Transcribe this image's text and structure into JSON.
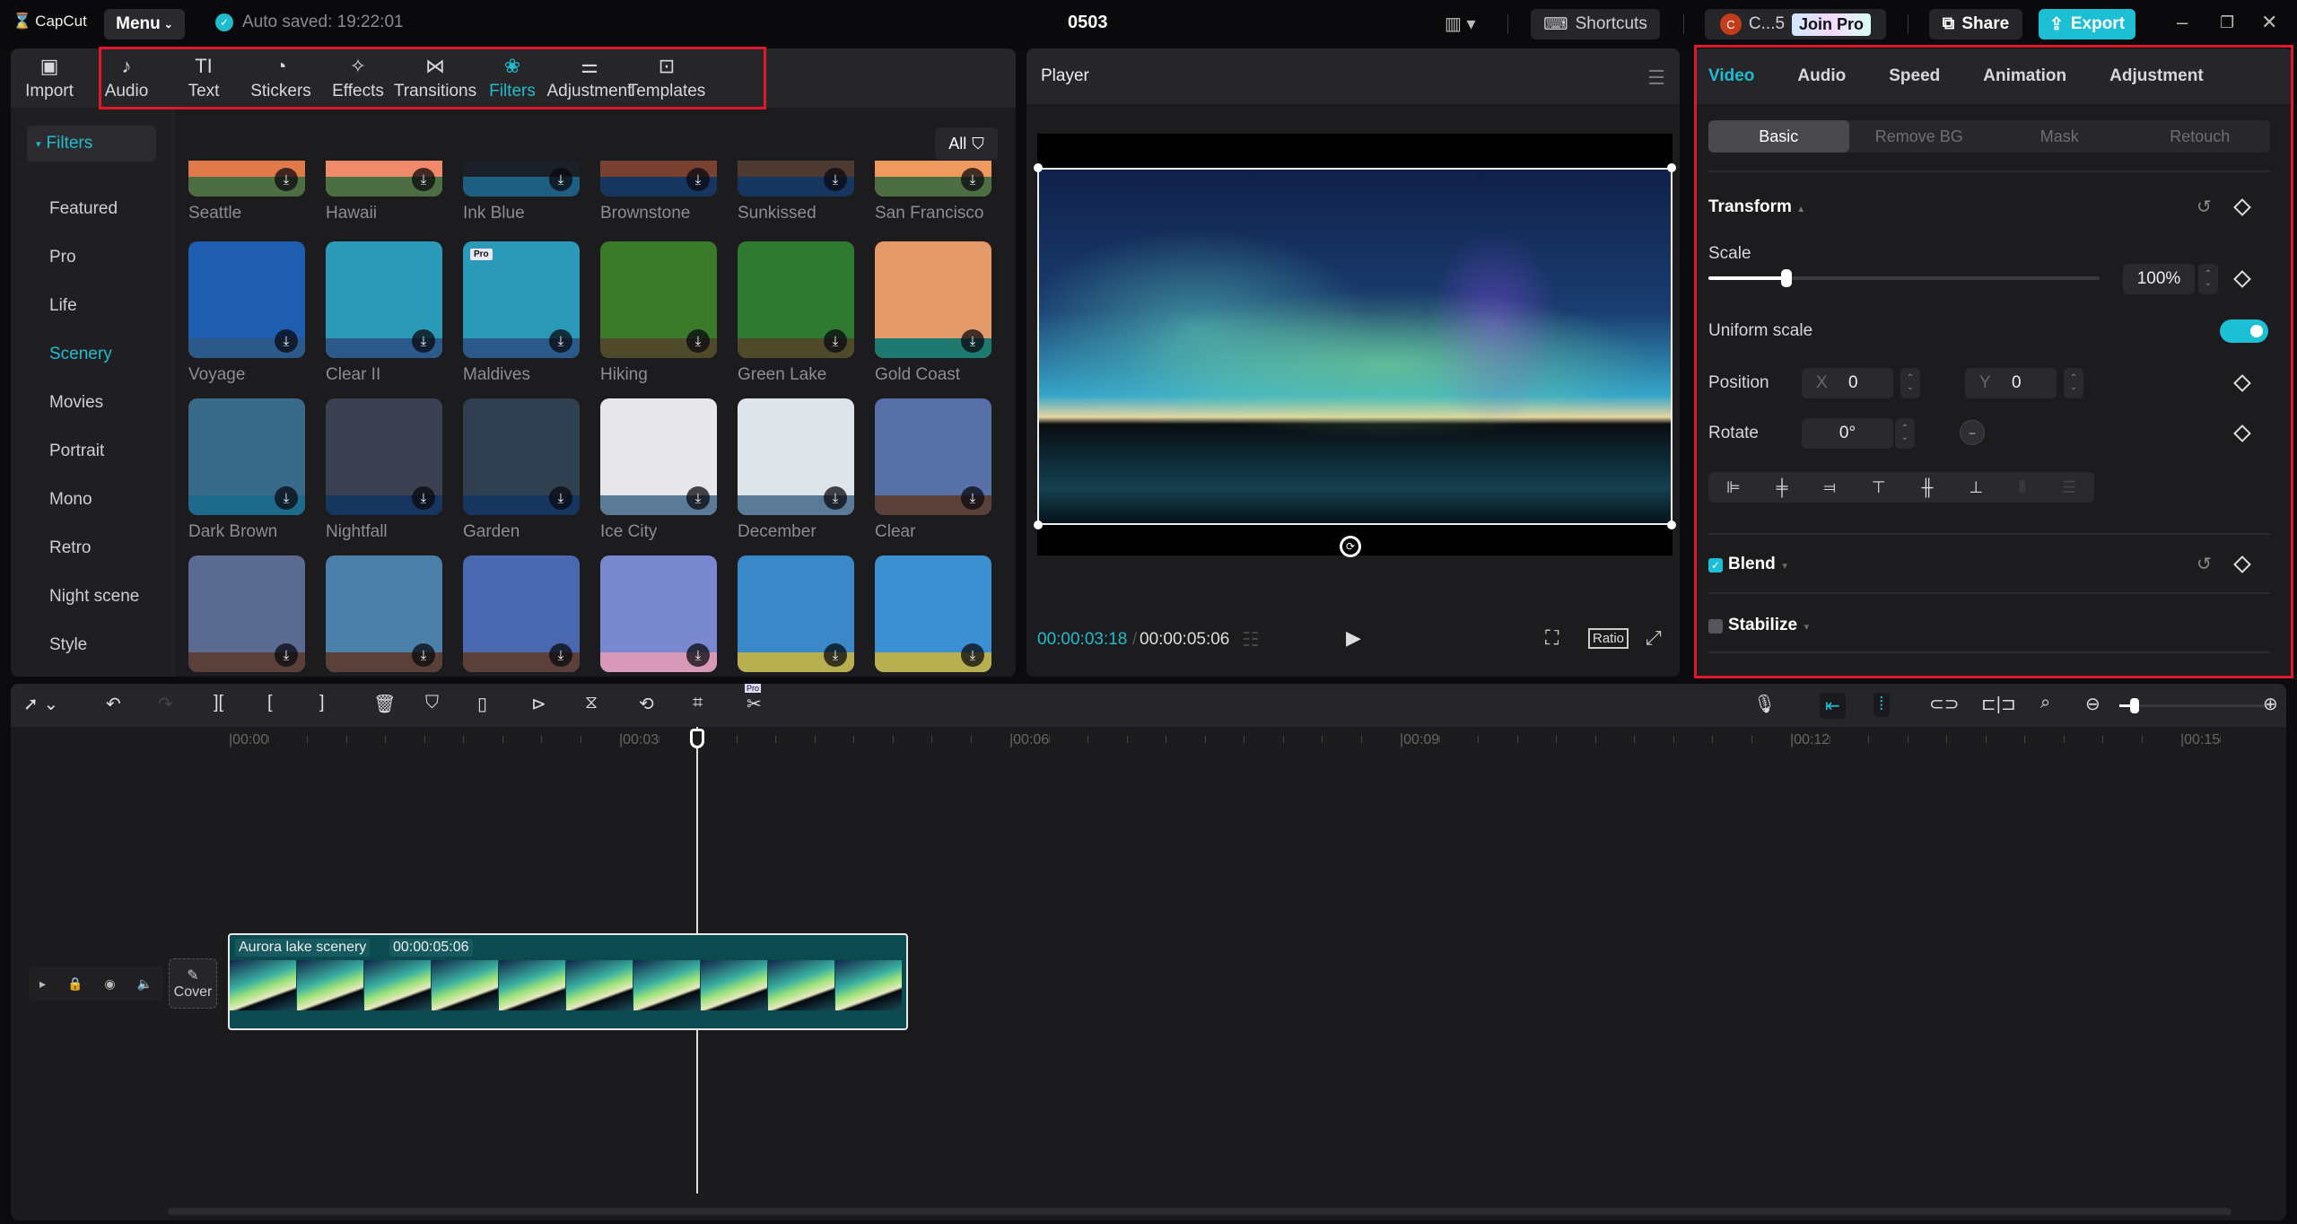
{
  "app": {
    "logo": "CapCut",
    "menu_label": "Menu",
    "autosave": "Auto saved: 19:22:01",
    "project_title": "0503"
  },
  "header": {
    "shortcuts_label": "Shortcuts",
    "user_initial": "C",
    "user_name": "C...5",
    "join_pro_label": "Join Pro",
    "share_label": "Share",
    "export_label": "Export"
  },
  "media_tabs": [
    {
      "label": "Import",
      "icon": "import-icon",
      "glyph": "▣"
    },
    {
      "label": "Audio",
      "icon": "audio-icon",
      "glyph": "♪"
    },
    {
      "label": "Text",
      "icon": "text-icon",
      "glyph": "TI"
    },
    {
      "label": "Stickers",
      "icon": "sticker-icon",
      "glyph": "◔"
    },
    {
      "label": "Effects",
      "icon": "effects-icon",
      "glyph": "✧"
    },
    {
      "label": "Transitions",
      "icon": "transitions-icon",
      "glyph": "⋈"
    },
    {
      "label": "Filters",
      "icon": "filters-icon",
      "glyph": "❀",
      "active": true
    },
    {
      "label": "Adjustment",
      "icon": "adjustment-icon",
      "glyph": "⚌"
    },
    {
      "label": "Templates",
      "icon": "templates-icon",
      "glyph": "⊡"
    }
  ],
  "sidebar": {
    "header": "Filters",
    "items": [
      "Featured",
      "Pro",
      "Life",
      "Scenery",
      "Movies",
      "Portrait",
      "Mono",
      "Retro",
      "Night scene",
      "Style"
    ],
    "active": "Scenery"
  },
  "filter_sort": "All",
  "filters": [
    {
      "name": "Seattle",
      "top": "#e07a4a",
      "band": "#4d6e42"
    },
    {
      "name": "Hawaii",
      "top": "#f08a6a",
      "band": "#4d6e42"
    },
    {
      "name": "Ink Blue",
      "top": "#1a1f28",
      "band": "#1e5e80"
    },
    {
      "name": "Brownstone",
      "top": "#7a4030",
      "band": "#163660"
    },
    {
      "name": "Sunkissed",
      "top": "#4e3a30",
      "band": "#163660"
    },
    {
      "name": "San Francisco",
      "top": "#f09a60",
      "band": "#4d6e42"
    },
    {
      "name": "Voyage",
      "top": "#1f5db0",
      "band": "#2b5a8a"
    },
    {
      "name": "Clear II",
      "top": "#2a9ab8",
      "band": "#2b5a8a"
    },
    {
      "name": "Maldives",
      "top": "#2a9ab8",
      "band": "#2b5a8a",
      "pro": true
    },
    {
      "name": "Hiking",
      "top": "#3a7a28",
      "band": "#4e4a2a"
    },
    {
      "name": "Green Lake",
      "top": "#2e7a30",
      "band": "#4e4a2a"
    },
    {
      "name": "Gold Coast",
      "top": "#e59a6a",
      "band": "#1e7a70"
    },
    {
      "name": "Dark Brown",
      "top": "#3a6a8a",
      "band": "#1e6a8a"
    },
    {
      "name": "Nightfall",
      "top": "#3a4050",
      "band": "#163660"
    },
    {
      "name": "Garden",
      "top": "#304050",
      "band": "#163660"
    },
    {
      "name": "Ice City",
      "top": "#e8e8ea",
      "band": "#5a7a98"
    },
    {
      "name": "December",
      "top": "#dde4ea",
      "band": "#5a7a98"
    },
    {
      "name": "Clear",
      "top": "#5870a8",
      "band": "#5a4038"
    },
    {
      "name": "",
      "top": "#5a6a90",
      "band": "#5a4038"
    },
    {
      "name": "",
      "top": "#4a80a8",
      "band": "#5a4038"
    },
    {
      "name": "",
      "top": "#4a68b0",
      "band": "#5a4038"
    },
    {
      "name": "",
      "top": "#7a88d0",
      "band": "#d898b8"
    },
    {
      "name": "",
      "top": "#3a88c8",
      "band": "#b8b050"
    },
    {
      "name": "",
      "top": "#3a90d0",
      "band": "#b8b050"
    }
  ],
  "player": {
    "title": "Player",
    "current_time": "00:00:03:18",
    "total_time": "00:00:05:06",
    "ratio_label": "Ratio"
  },
  "inspector": {
    "tabs": [
      "Video",
      "Audio",
      "Speed",
      "Animation",
      "Adjustment"
    ],
    "active_tab": "Video",
    "subtabs": [
      "Basic",
      "Remove BG",
      "Mask",
      "Retouch"
    ],
    "active_subtab": "Basic",
    "transform_label": "Transform",
    "scale_label": "Scale",
    "scale_value": "100%",
    "scale_slider_fraction": 0.2,
    "uniform_scale_label": "Uniform scale",
    "uniform_scale_on": true,
    "position_label": "Position",
    "pos_x_label": "X",
    "pos_x": "0",
    "pos_y_label": "Y",
    "pos_y": "0",
    "rotate_label": "Rotate",
    "rotate_value": "0°",
    "blend_label": "Blend",
    "blend_checked": true,
    "stabilize_label": "Stabilize",
    "stabilize_checked": false
  },
  "timeline": {
    "ruler": [
      "00:00",
      "00:03",
      "00:06",
      "00:09",
      "00:12",
      "00:15"
    ],
    "cover_label": "Cover",
    "clip_name": "Aurora lake scenery",
    "clip_duration": "00:00:05:06",
    "zoom_fraction": 0.1
  },
  "colors": {
    "accent": "#1fbcd0",
    "highlight_box": "#e0182b"
  }
}
